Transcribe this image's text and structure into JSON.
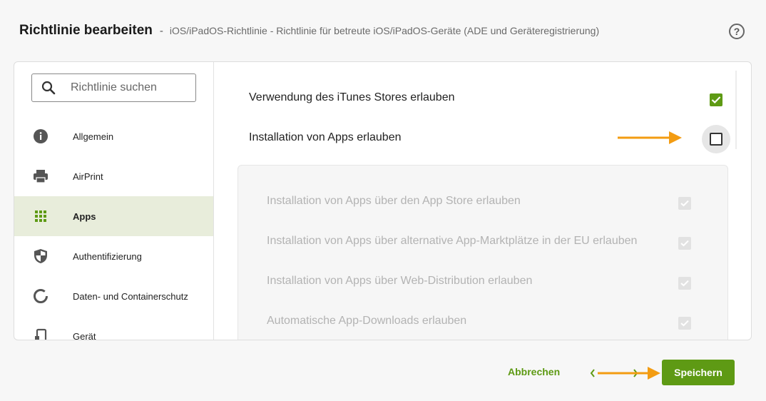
{
  "header": {
    "title": "Richtlinie bearbeiten",
    "separator": "-",
    "subtitle": "iOS/iPadOS-Richtlinie - Richtlinie für betreute iOS/iPadOS-Geräte (ADE und Geräteregistrierung)",
    "help_icon": "help-circle-icon"
  },
  "sidebar": {
    "search": {
      "placeholder": "Richtlinie suchen",
      "value": ""
    },
    "items": [
      {
        "label": "Allgemein",
        "icon": "info-icon",
        "active": false
      },
      {
        "label": "AirPrint",
        "icon": "printer-icon",
        "active": false
      },
      {
        "label": "Apps",
        "icon": "apps-grid-icon",
        "active": true
      },
      {
        "label": "Authentifizierung",
        "icon": "shield-icon",
        "active": false
      },
      {
        "label": "Daten- und Containerschutz",
        "icon": "circle-progress-icon",
        "active": false
      },
      {
        "label": "Gerät",
        "icon": "device-icon",
        "active": false
      }
    ]
  },
  "main": {
    "settings": [
      {
        "label": "Verwendung des iTunes Stores erlauben",
        "checked": true
      },
      {
        "label": "Installation von Apps erlauben",
        "checked": false
      }
    ],
    "dependent_settings": [
      {
        "label": "Installation von Apps über den App Store erlauben",
        "checked": true,
        "disabled": true
      },
      {
        "label": "Installation von Apps über alternative App-Marktplätze in der EU erlauben",
        "checked": true,
        "disabled": true
      },
      {
        "label": "Installation von Apps über Web-Distribution erlauben",
        "checked": true,
        "disabled": true
      },
      {
        "label": "Automatische App-Downloads erlauben",
        "checked": true,
        "disabled": true
      }
    ]
  },
  "footer": {
    "cancel_label": "Abbrechen",
    "save_label": "Speichern"
  },
  "colors": {
    "accent": "#5e9a14",
    "active_nav_bg": "#e8eddb",
    "annotation_arrow": "#f39c12"
  }
}
